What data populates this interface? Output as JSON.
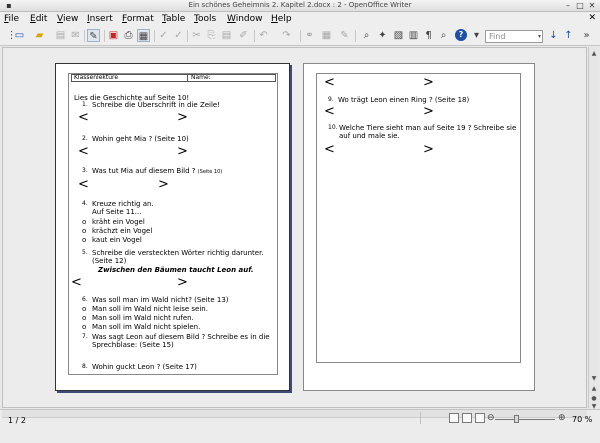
{
  "window": {
    "title": "Ein schönes Geheimnis  2. Kapitel 2.docx : 2 - OpenOffice Writer"
  },
  "menu": {
    "file": {
      "u": "F",
      "rest": "ile"
    },
    "edit": {
      "u": "E",
      "rest": "dit"
    },
    "view": {
      "u": "V",
      "rest": "iew"
    },
    "insert": {
      "u": "I",
      "rest": "nsert"
    },
    "format": {
      "u": "F",
      "rest": "ormat"
    },
    "table": {
      "u": "T",
      "rest": "able"
    },
    "tools": {
      "u": "T",
      "rest": "ools"
    },
    "window": {
      "u": "W",
      "rest": "indow"
    },
    "help": {
      "u": "H",
      "rest": "elp"
    }
  },
  "toolbar": {
    "find_placeholder": "Find"
  },
  "page1": {
    "header": {
      "left": "Klassenlektüre",
      "right": "Name:"
    },
    "intro": "Lies die Geschichte auf Seite 10!",
    "q1": {
      "n": "1.",
      "text": "Schreibe die Überschrift in die Zeile!"
    },
    "q2": {
      "n": "2.",
      "text": "Wohin geht Mia ? (Seite 10)"
    },
    "q3": {
      "n": "3.",
      "text": "Was tut Mia auf diesem Bild ?",
      "page": "(Seite 10)"
    },
    "q4": {
      "n": "4.",
      "line1": "Kreuze richtig an.",
      "line2": "Auf Seite 11...",
      "options": [
        "kräht ein Vogel",
        "krächzt ein Vogel",
        "kaut ein Vogel"
      ]
    },
    "q5": {
      "n": "5.",
      "line1": "Schreibe die versteckten Wörter richtig darunter.",
      "line2": "(Seite 12)",
      "sentence": "Zwischen den Bäumen taucht Leon auf."
    },
    "q6": {
      "n": "6.",
      "text": "Was soll man im Wald nicht? (Seite 13)",
      "options": [
        "Man soll im Wald nicht leise sein.",
        "Man soll im Wald nicht rufen.",
        "Man soll im Wald nicht spielen."
      ]
    },
    "q7": {
      "n": "7.",
      "line1": "Was sagt Leon auf diesem Bild ? Schreibe es in die",
      "line2": "Sprechblase: (Seite 15)"
    },
    "q8": {
      "n": "8.",
      "text": "Wohin guckt Leon ? (Seite 17)"
    },
    "arrow_left": "<",
    "arrow_right": ">",
    "bullet": "o"
  },
  "page2": {
    "q9": {
      "n": "9.",
      "text": "Wo trägt Leon einen Ring ? (Seite 18)"
    },
    "q10": {
      "n": "10.",
      "line1": "Welche Tiere sieht man auf Seite 19 ? Schreibe sie",
      "line2": "auf und male sie."
    }
  },
  "status": {
    "page": "1 / 2",
    "zoom": "70 %",
    "zoom_minus": "⊖",
    "zoom_plus": "⊕"
  }
}
